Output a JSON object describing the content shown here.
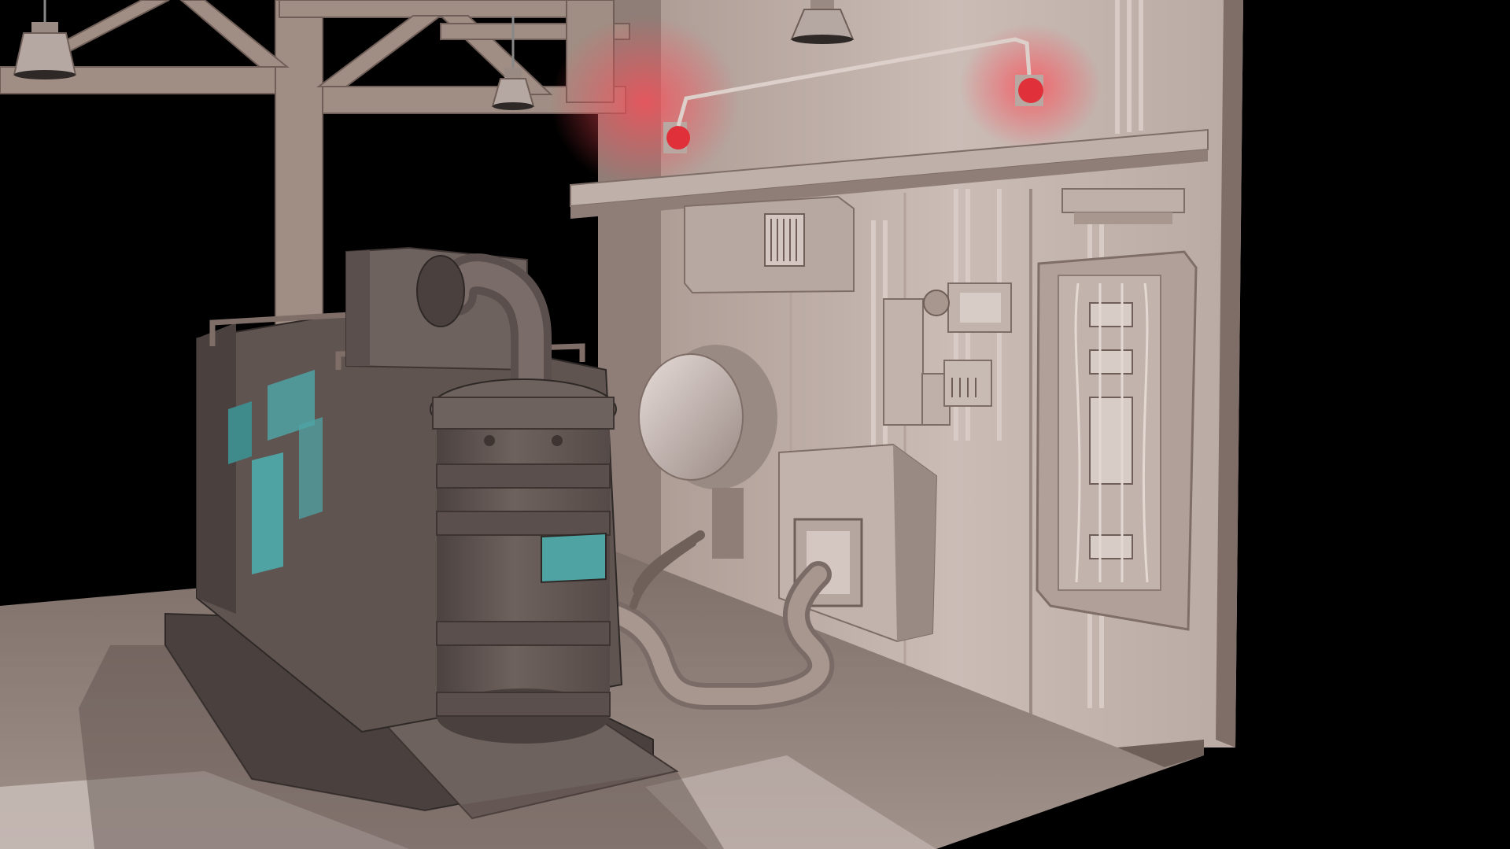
{
  "scene": {
    "palette": {
      "background": "#000000",
      "wall_light": "#cbbcb6",
      "wall_mid": "#a8978f",
      "wall_dark": "#7f6e67",
      "floor": "#8f7f79",
      "floor_light": "#c9bdb8",
      "machine_dark": "#5a4f4c",
      "machine_mid": "#6e625e",
      "accent_teal": "#4fa3a3",
      "alarm_red": "#e0303a",
      "glow_red": "#ff4a55"
    },
    "icons": [
      "ceiling-lamp-icon",
      "alarm-light-icon",
      "vent-grille-icon",
      "gauge-icon"
    ]
  }
}
